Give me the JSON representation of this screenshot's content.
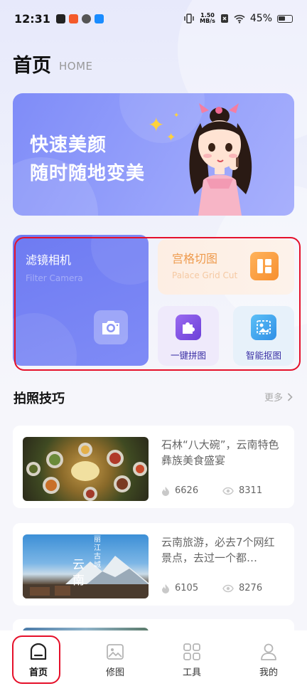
{
  "status_bar": {
    "time": "12:31",
    "net_speed_value": "1.50",
    "net_speed_unit": "MB/s",
    "battery": "45%"
  },
  "header": {
    "title": "首页",
    "subtitle": "HOME"
  },
  "banner": {
    "line1": "快速美颜",
    "line2": "随时随地变美"
  },
  "features": {
    "filter_camera": {
      "title": "滤镜相机",
      "subtitle": "Filter Camera"
    },
    "palace_grid": {
      "title": "宫格切图",
      "subtitle": "Palace Grid Cut"
    },
    "puzzle": {
      "label": "一键拼图"
    },
    "cutout": {
      "label": "智能抠图"
    }
  },
  "tips": {
    "title": "拍照技巧",
    "more": "更多",
    "articles": [
      {
        "title": "石林“八大碗”，云南特色彝族美食盛宴",
        "likes": "6626",
        "views": "8311"
      },
      {
        "title": "云南旅游，必去7个网红景点，去过一个都…",
        "likes": "6105",
        "views": "8276",
        "thumb_text_main": "云南",
        "thumb_text_side": "丽江古城"
      }
    ]
  },
  "bottom_nav": {
    "items": [
      {
        "label": "首页",
        "icon": "home-icon",
        "active": true
      },
      {
        "label": "修图",
        "icon": "image-edit-icon",
        "active": false
      },
      {
        "label": "工具",
        "icon": "tools-grid-icon",
        "active": false
      },
      {
        "label": "我的",
        "icon": "profile-icon",
        "active": false
      }
    ]
  },
  "colors": {
    "accent": "#7f8bf6",
    "highlight": "#e5102a",
    "palace_orange": "#ee9a4c",
    "puzzle_purple": "#7a4bdf",
    "cutout_blue": "#3da6f0"
  }
}
